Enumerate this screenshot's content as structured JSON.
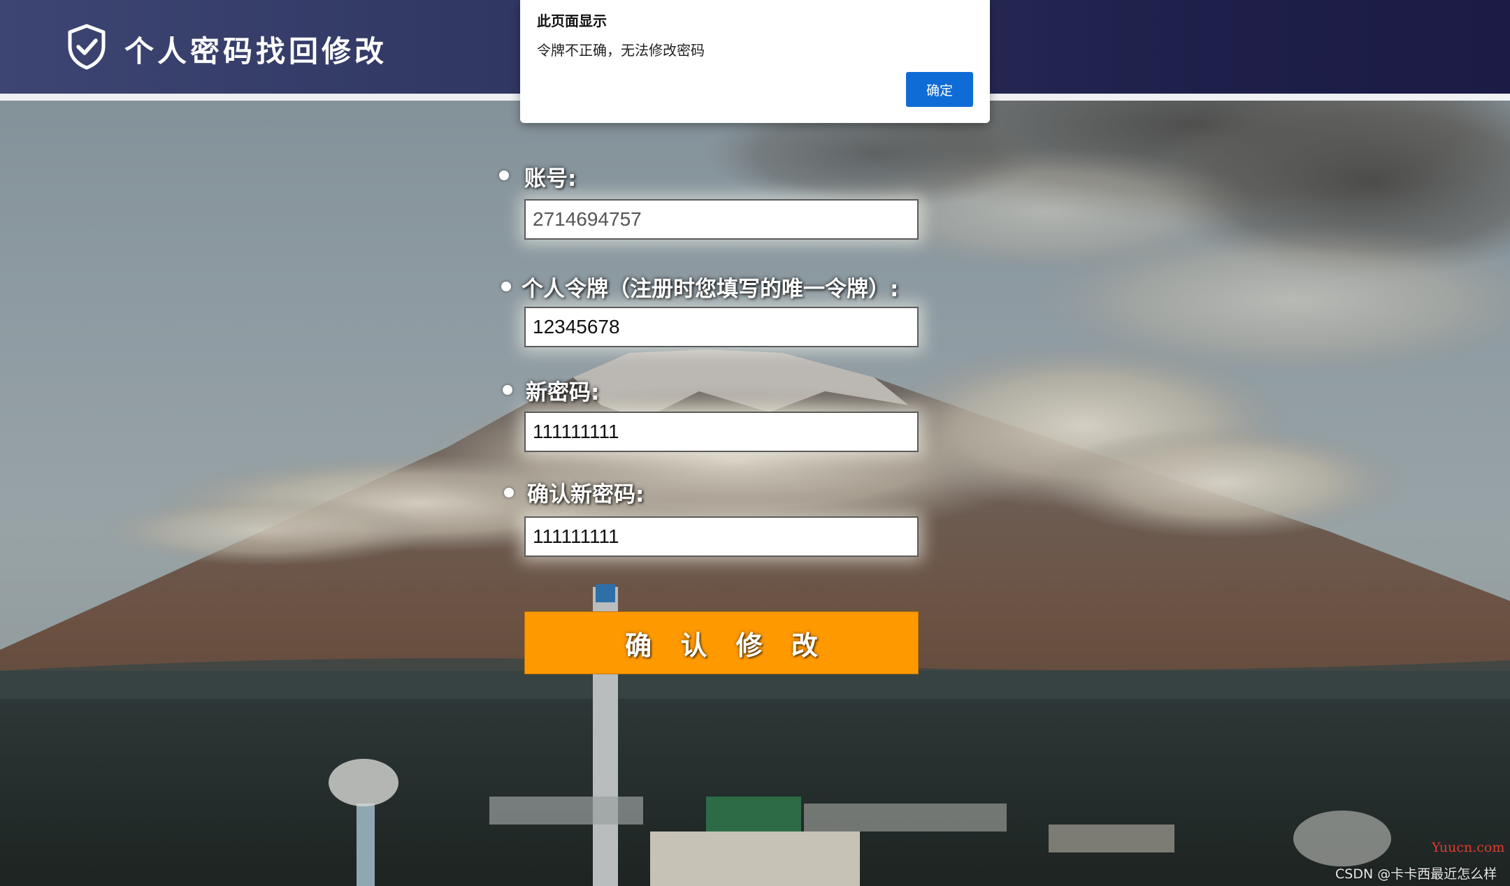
{
  "header": {
    "title": "个人密码找回修改",
    "icon": "shield-check-icon"
  },
  "form": {
    "account": {
      "label": "账号:",
      "value": "2714694757"
    },
    "token": {
      "label": "个人令牌（注册时您填写的唯一令牌）:",
      "value": "12345678"
    },
    "new_password": {
      "label": "新密码:",
      "value": "111111111"
    },
    "confirm_password": {
      "label": "确认新密码:",
      "value": "111111111"
    },
    "submit_label": "确 认 修 改"
  },
  "dialog": {
    "title": "此页面显示",
    "message": "令牌不正确，无法修改密码",
    "ok_label": "确定"
  },
  "watermark": {
    "site": "Yuucn.com",
    "credit": "CSDN @卡卡西最近怎么样"
  },
  "colors": {
    "header_start": "#3d4572",
    "header_end": "#1b1b45",
    "submit_button": "#ff9900",
    "dialog_button": "#0f6cd6"
  }
}
